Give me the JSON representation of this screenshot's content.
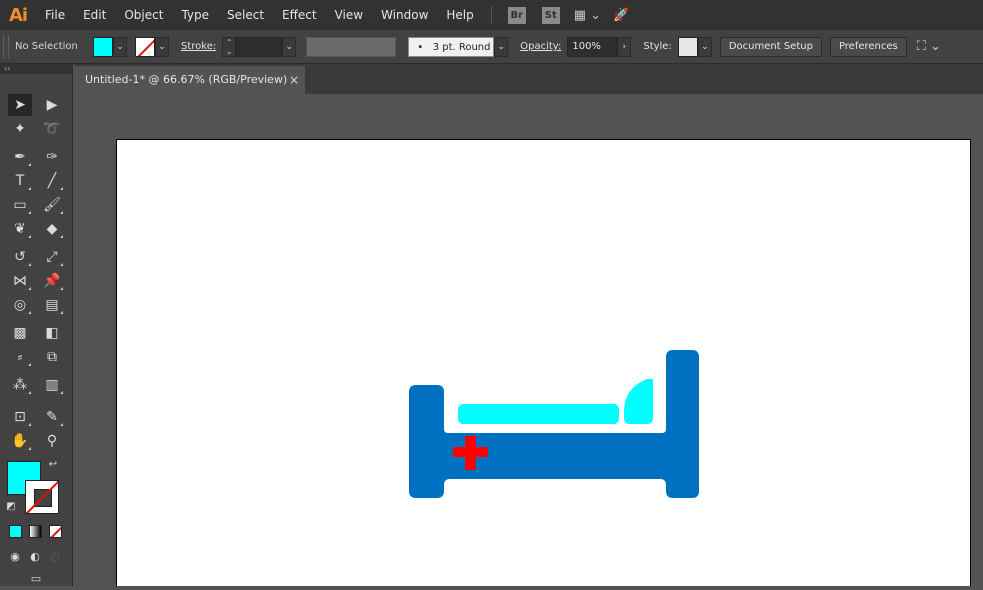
{
  "app": {
    "logo": "Ai"
  },
  "menu": [
    "File",
    "Edit",
    "Object",
    "Type",
    "Select",
    "Effect",
    "View",
    "Window",
    "Help"
  ],
  "menu_badges": {
    "bridge": "Br",
    "stock": "St"
  },
  "control_bar": {
    "selection_label": "No Selection",
    "fill_color": "#00ffff",
    "stroke_label": "Stroke:",
    "brush_label": "3 pt. Round",
    "brush_dot": "•",
    "opacity_label": "Opacity:",
    "opacity_value": "100%",
    "style_label": "Style:",
    "document_setup": "Document Setup",
    "preferences": "Preferences"
  },
  "document_tab": {
    "title": "Untitled-1* @ 66.67% (RGB/Preview)",
    "close": "×"
  },
  "toolbar": {
    "collapse": "‹‹",
    "fill_color": "#00ffff"
  },
  "artwork": {
    "bed_color": "#0070c0",
    "pillow_color": "#00ffff",
    "cross_color": "#ff0000",
    "background": "#ffffff"
  }
}
